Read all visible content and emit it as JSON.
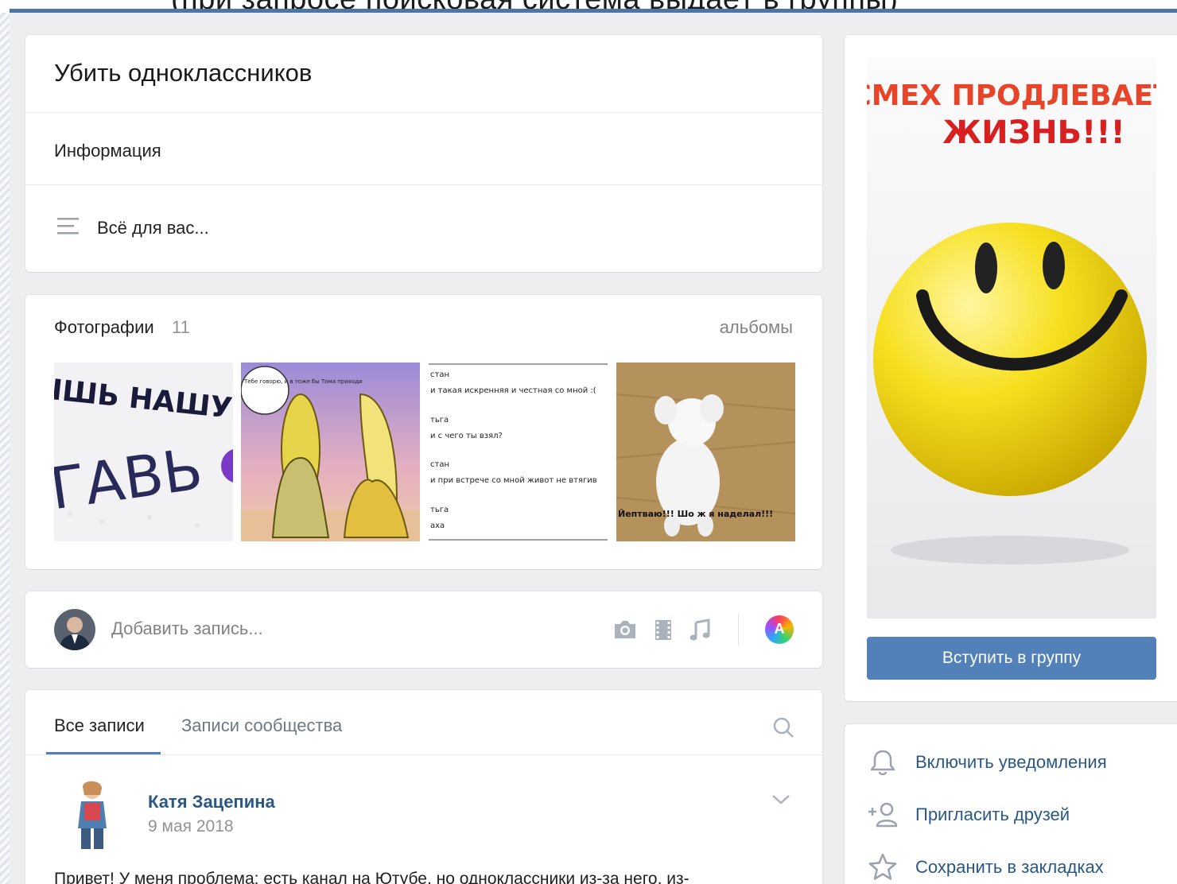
{
  "caption": "(при запросе поисковая система выдаёт в группы)",
  "group": {
    "title": "Убить одноклассников",
    "info_label": "Информация",
    "description": "Всё для вас..."
  },
  "photos": {
    "title": "Фотографии",
    "count": "11",
    "albums_link": "альбомы",
    "thumb1_text_top": "ІШЬ НАШУ ГР",
    "thumb1_text_bottom": "ГАВЬ",
    "thumb2_bubble": "Тебе говорю, и в тоже бы Тома приходи",
    "thumb3_lines": [
      "стан",
      "и такая искренняя и честная со мной :(",
      "тьга",
      "и с чего ты взял?",
      "стан",
      "и при встрече со мной живот не втягив",
      "тьга",
      "аха"
    ],
    "thumb4_caption": "Йептваю!!! Шо ж я наделал!!!"
  },
  "composer": {
    "placeholder": "Добавить запись...",
    "theme_letter": "A"
  },
  "wall": {
    "tab_all": "Все записи",
    "tab_community": "Записи сообщества",
    "post": {
      "author": "Катя Зацепина",
      "date": "9 мая 2018",
      "text": "Привет! У меня проблема: есть канал на Ютубе, но одноклассники из-за него, из-"
    }
  },
  "sidebar": {
    "cover_text_line1": "СМЕХ ПРОДЛЕВАЕТ",
    "cover_text_line2": "ЖИЗНЬ!!!",
    "join_button": "Вступить в группу",
    "actions": {
      "notify": "Включить уведомления",
      "invite": "Пригласить друзей",
      "bookmark": "Сохранить в закладках"
    }
  },
  "colors": {
    "accent": "#5181b8",
    "link": "#2a5885",
    "page_bg": "#edeef0"
  }
}
